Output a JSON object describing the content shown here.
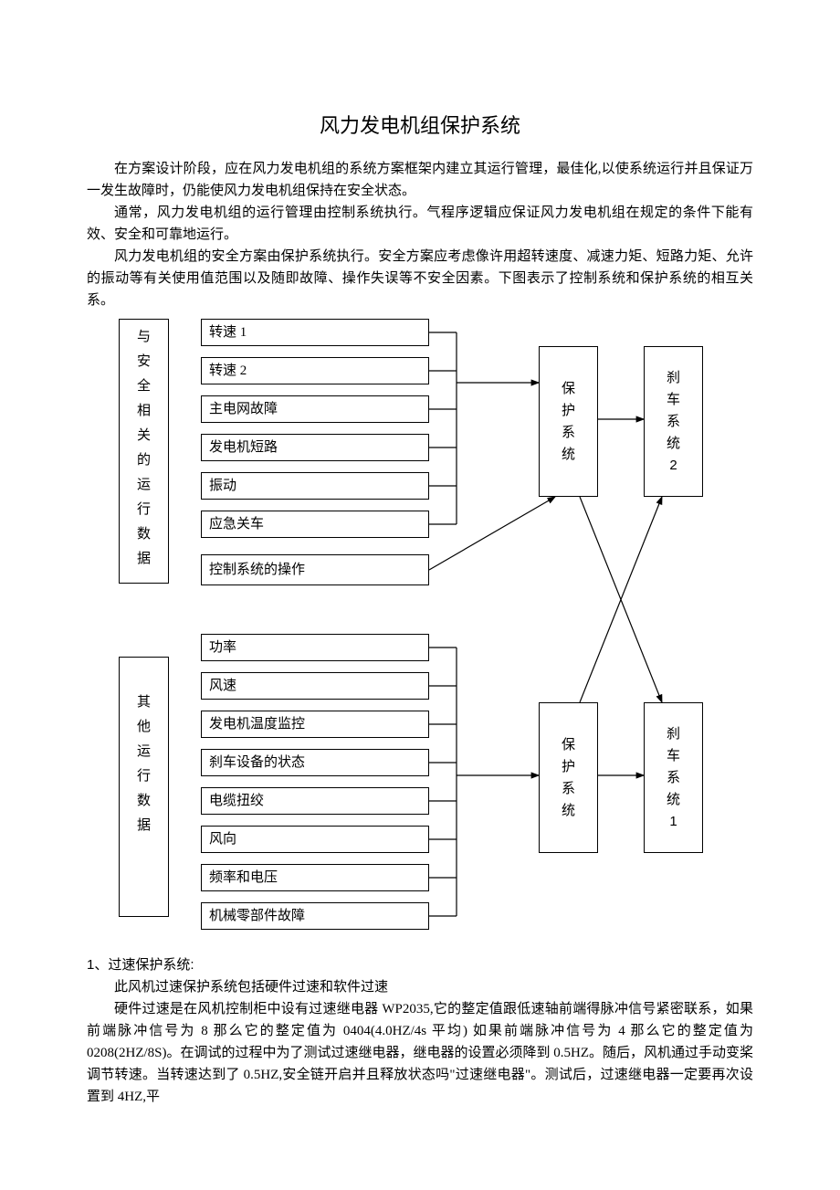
{
  "title": "风力发电机组保护系统",
  "p1": "在方案设计阶段，应在风力发电机组的系统方案框架内建立其运行管理，最佳化,以使系统运行并且保证万一发生故障时，仍能使风力发电机组保持在安全状态。",
  "p2": "通常，风力发电机组的运行管理由控制系统执行。气程序逻辑应保证风力发电机组在规定的条件下能有效、安全和可靠地运行。",
  "p3": "风力发电机组的安全方案由保护系统执行。安全方案应考虑像许用超转速度、减速力矩、短路力矩、允许的振动等有关使用值范围以及随即故障、操作失误等不安全因素。下图表示了控制系统和保护系统的相互关系。",
  "diagram": {
    "leftTop": "与安全相关的运行数据",
    "leftBottom": "其他运行数据",
    "group1": [
      "转速 1",
      "转速 2",
      "主电网故障",
      "发电机短路",
      "振动",
      "应急关车",
      "控制系统的操作"
    ],
    "group2": [
      "功率",
      "风速",
      "发电机温度监控",
      "刹车设备的状态",
      "电缆扭绞",
      "风向",
      "频率和电压",
      "机械零部件故障"
    ],
    "protect": "保护系统",
    "brake2": "刹车系统2",
    "brake1": "刹车系统1"
  },
  "sec1_head": "1、过速保护系统:",
  "sec1_p1": "此风机过速保护系统包括硬件过速和软件过速",
  "sec1_p2": "硬件过速是在风机控制柜中设有过速继电器 WP2035,它的整定值跟低速轴前端得脉冲信号紧密联系，如果前端脉冲信号为 8 那么它的整定值为 0404(4.0HZ/4s 平均) 如果前端脉冲信号为 4 那么它的整定值为 0208(2HZ/8S)。在调试的过程中为了测试过速继电器，继电器的设置必须降到 0.5HZ。随后，风机通过手动变桨调节转速。当转速达到了 0.5HZ,安全链开启并且释放状态吗\"过速继电器\"。测试后，过速继电器一定要再次设置到 4HZ,平"
}
